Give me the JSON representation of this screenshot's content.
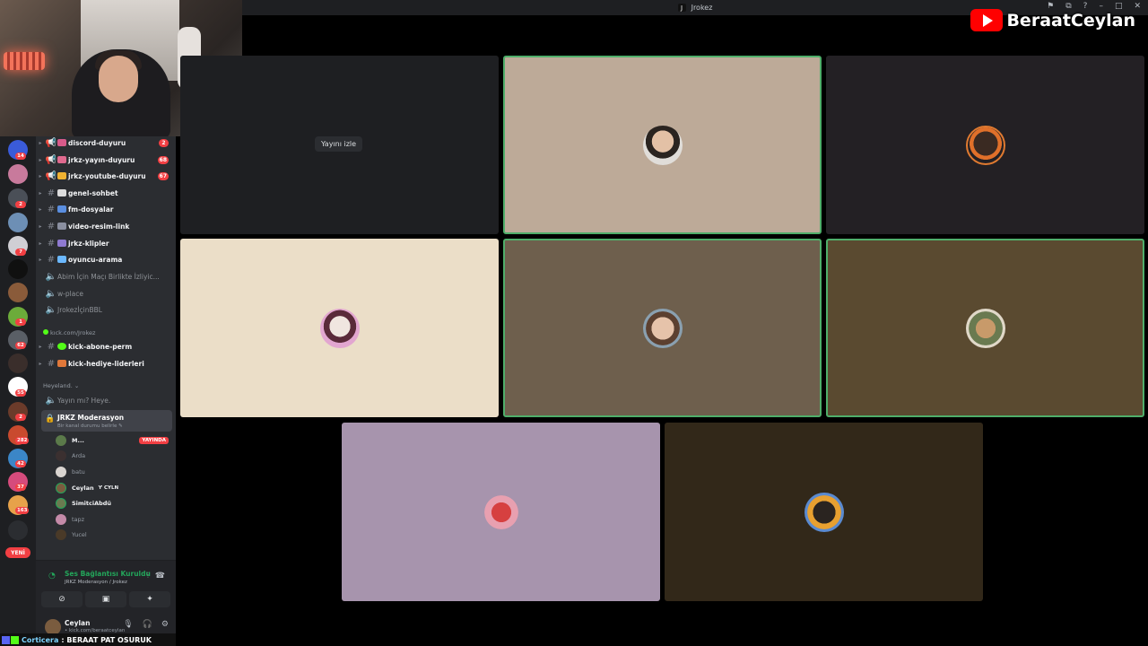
{
  "window": {
    "title": "Jrokez",
    "logo_letter": "J",
    "controls": [
      "⚑",
      "⧉",
      "?",
      "–",
      "□",
      "✕"
    ]
  },
  "watermark": {
    "channel": "BeraatCeylan"
  },
  "server_rail": {
    "badges": [
      "14",
      "2",
      "7",
      "1",
      "62",
      "55",
      "2",
      "282",
      "42",
      "37",
      "163"
    ],
    "new_label": "YENİ"
  },
  "channels": [
    {
      "name": "discord-duyuru",
      "kind": "announce",
      "badge": "2"
    },
    {
      "name": "jrkz-yayın-duyuru",
      "kind": "announce",
      "badge": "68"
    },
    {
      "name": "jrkz-youtube-duyuru",
      "kind": "announce",
      "badge": "67"
    },
    {
      "name": "genel-sohbet",
      "kind": "text"
    },
    {
      "name": "fm-dosyalar",
      "kind": "text"
    },
    {
      "name": "video-resim-link",
      "kind": "text"
    },
    {
      "name": "jrkz-klipler",
      "kind": "text"
    },
    {
      "name": "oyuncu-arama",
      "kind": "text"
    },
    {
      "name": "Abim İçin Maçı Birlikte İzliyic...",
      "kind": "voice"
    },
    {
      "name": "w-place",
      "kind": "voice"
    },
    {
      "name": "JrokezİçinBBL",
      "kind": "voice"
    }
  ],
  "category_kick": "kıck.com/Jrokez",
  "kick_channels": [
    {
      "name": "kick-abone-perm"
    },
    {
      "name": "kick-hediye-liderleri"
    }
  ],
  "category_heyeland": "Heyeland. ⌄",
  "heyeland_channels": [
    {
      "name": "Yayın mı? Heye."
    }
  ],
  "active_voice": {
    "name": "JRKZ Moderasyon",
    "status": "Bir kanal durumu belirle ✎",
    "members": [
      {
        "name": "M...",
        "live": "YAYINDA"
      },
      {
        "name": "Arda"
      },
      {
        "name": "batu"
      },
      {
        "name": "Ceylan",
        "tag": "Ƴ CYLN"
      },
      {
        "name": "SimitciAbdü"
      },
      {
        "name": "tapz"
      },
      {
        "name": "Yucel"
      }
    ]
  },
  "voice_status": {
    "title": "Ses Bağlantısı Kuruldu",
    "subtitle": "JRKZ Moderasyon / Jrokez"
  },
  "user": {
    "name": "Ceylan",
    "subtitle": "• kick.com/beraatceylan"
  },
  "chat_overlay": {
    "user": "Corticera",
    "message": ": BERAAT PAT OSURUK"
  },
  "stream_tile": {
    "button_label": "Yayını izle"
  },
  "colors": {
    "speaking_border": "#4fae6a",
    "tiles": [
      "#1e1f22",
      "#bdaa98",
      "#232024",
      "#ebdec8",
      "#6e5f4d",
      "#5a4a30",
      "#a794ad",
      "#322819"
    ]
  }
}
